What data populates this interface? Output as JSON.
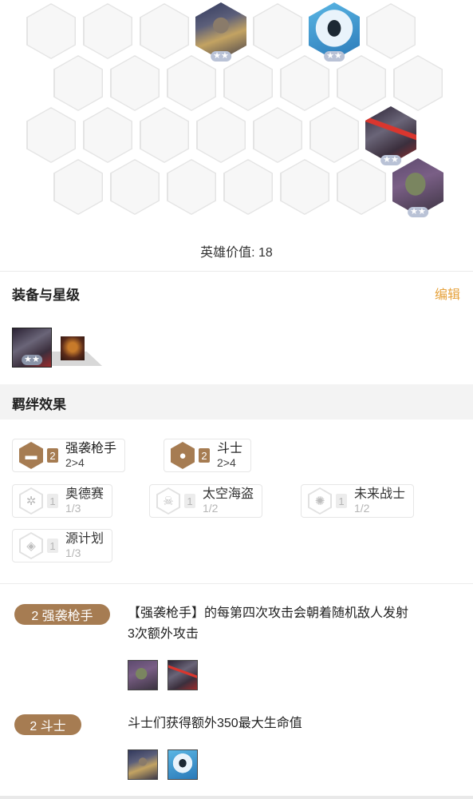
{
  "board": {
    "champions": [
      {
        "name": "guard-champion",
        "stars": 2
      },
      {
        "name": "robot-champion",
        "stars": 2
      },
      {
        "name": "mech-champion",
        "stars": 2
      },
      {
        "name": "brute-champion",
        "stars": 2
      }
    ],
    "hero_value_label": "英雄价值: 18"
  },
  "equipment": {
    "title": "装备与星级",
    "edit_label": "编辑",
    "selected_champion_stars": 2
  },
  "bonds": {
    "title": "羁绊效果",
    "traits": [
      {
        "name": "强袭枪手",
        "count": "2",
        "progress": "2>4",
        "active": true,
        "icon": "gun-icon"
      },
      {
        "name": "斗士",
        "count": "2",
        "progress": "2>4",
        "active": true,
        "icon": "fist-icon"
      },
      {
        "name": "奥德赛",
        "count": "1",
        "progress": "1/3",
        "active": false,
        "icon": "odyssey-icon"
      },
      {
        "name": "太空海盗",
        "count": "1",
        "progress": "1/2",
        "active": false,
        "icon": "pirate-skull-icon"
      },
      {
        "name": "未来战士",
        "count": "1",
        "progress": "1/2",
        "active": false,
        "icon": "aperture-icon"
      },
      {
        "name": "源计划",
        "count": "1",
        "progress": "1/3",
        "active": false,
        "icon": "project-icon"
      }
    ]
  },
  "effects": [
    {
      "pill": "2 强袭枪手",
      "line1": "【强袭枪手】的每第四次攻击会朝着随机敌人发射",
      "line2": "3次额外攻击"
    },
    {
      "pill": "2 斗士",
      "line1": "斗士们获得额外350最大生命值",
      "line2": ""
    }
  ],
  "colors": {
    "accent": "#a67c52",
    "edit": "#e6a23c"
  }
}
